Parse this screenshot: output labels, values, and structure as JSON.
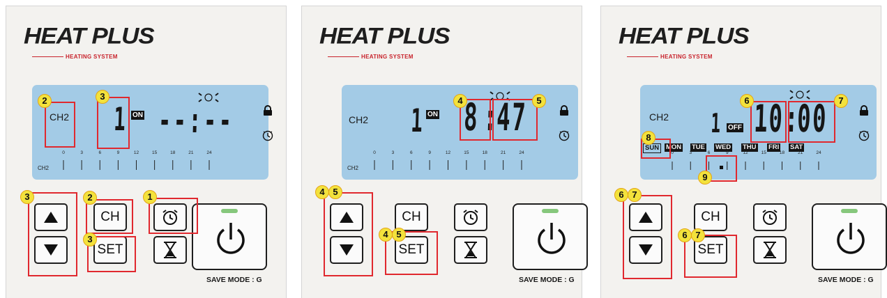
{
  "brand": {
    "logo": "HEAT PLUS",
    "subtitle": "HEATING SYSTEM"
  },
  "common": {
    "btn_ch": "CH",
    "btn_set": "SET",
    "save_mode": "SAVE MODE : G",
    "scale_labels": [
      "0",
      "3",
      "6",
      "9",
      "12",
      "15",
      "18",
      "21",
      "24"
    ],
    "scale_channel": "CH2"
  },
  "panels": [
    {
      "channel": "CH2",
      "program_number": "1",
      "state_tag": "ON",
      "time": "--:--",
      "badges": {
        "alarm_button": "1",
        "channel": "2",
        "program": "3",
        "ch_button": "2",
        "arrows": "3",
        "set_button": "3"
      }
    },
    {
      "channel": "CH2",
      "program_number": "1",
      "state_tag": "ON",
      "time_hour": "8",
      "time_minute": "47",
      "badges": {
        "hour": "4",
        "minute": "5",
        "arrows_a": "4",
        "arrows_b": "5",
        "set_a": "4",
        "set_b": "5"
      }
    },
    {
      "channel": "CH2",
      "program_number": "1",
      "state_tag": "OFF",
      "time_hour": "10",
      "time_minute": "00",
      "days": [
        "SUN",
        "MON",
        "TUE",
        "WED",
        "THU",
        "FRI",
        "SAT"
      ],
      "selected_day": "SUN",
      "badges": {
        "hour": "6",
        "minute": "7",
        "day": "8",
        "marker": "9",
        "arrows_a": "6",
        "arrows_b": "7",
        "set_a": "6",
        "set_b": "7"
      }
    }
  ],
  "colors": {
    "lcd": "#a3cbe6",
    "highlight": "#e0282e",
    "badge": "#f3e23c",
    "brand_red": "#c8232c",
    "led": "#86c77c"
  },
  "icons": [
    "alarm-clock-icon",
    "hourglass-icon",
    "power-icon",
    "lock-icon",
    "clock-icon",
    "arrow-up-icon",
    "arrow-down-icon"
  ]
}
